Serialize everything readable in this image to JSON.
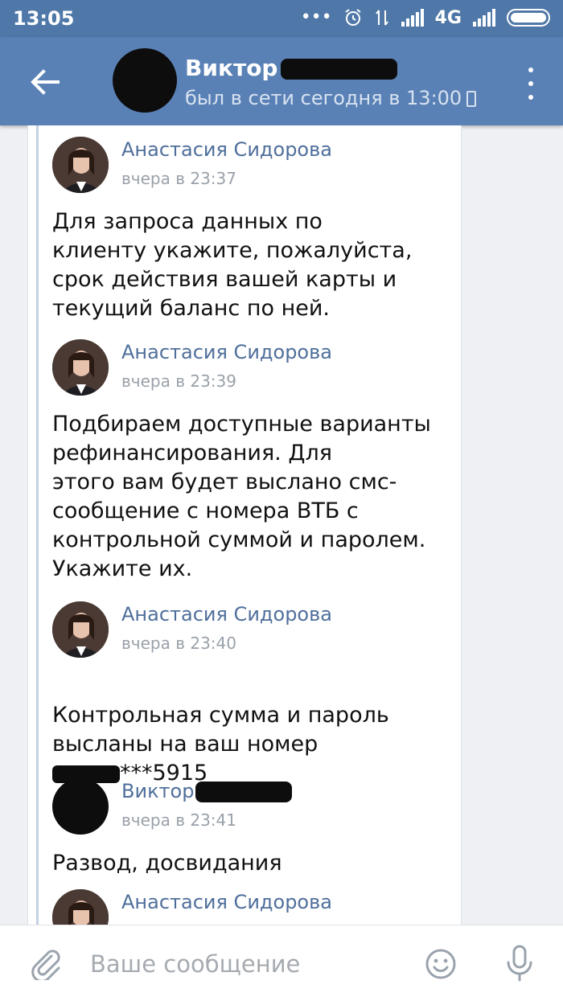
{
  "status_bar": {
    "time": "13:05",
    "icons": [
      "more-icon",
      "alarm-icon",
      "data-off-icon",
      "signal-icon",
      "network-type-icon",
      "signal-icon",
      "battery-icon"
    ],
    "network_type": "4G",
    "battery_level": 1.0
  },
  "header": {
    "title": "Виктор",
    "subtitle": "был в сети сегодня в 13:00",
    "back_icon": "arrow-left-icon",
    "menu_icon": "more-vertical-icon"
  },
  "messages": [
    {
      "author": "Анастасия Сидорова",
      "date": "вчера в 23:37",
      "text": "Для запроса данных по\nклиенту укажите, пожалуйста,\nсрок действия вашей карты и\nтекущий баланс по ней."
    },
    {
      "author": "Анастасия Сидорова",
      "date": "вчера в 23:39",
      "text": "Подбираем доступные варианты\nрефинансирования. Для\nэтого вам будет выслано смс-\nсообщение с номера ВТБ с\nконтрольной суммой и паролем.\nУкажите их."
    },
    {
      "author": "Анастасия Сидорова",
      "date": "вчера в 23:40",
      "text": "Контрольная сумма и пароль\nвысланы на ваш номер",
      "text_suffix": "***5915"
    },
    {
      "author": "Виктор",
      "date": "вчера в 23:41",
      "text": "Развод, досвидания"
    },
    {
      "author": "Анастасия Сидорова",
      "date": "",
      "text": ""
    }
  ],
  "composer": {
    "placeholder": "Ваше сообщение",
    "attach_icon": "paperclip-icon",
    "emoji_icon": "smile-icon",
    "voice_icon": "microphone-icon"
  },
  "colors": {
    "header_bg": "#5a81b6",
    "statusbar_bg": "#4f78a8",
    "author_name": "#4f6f9b"
  }
}
